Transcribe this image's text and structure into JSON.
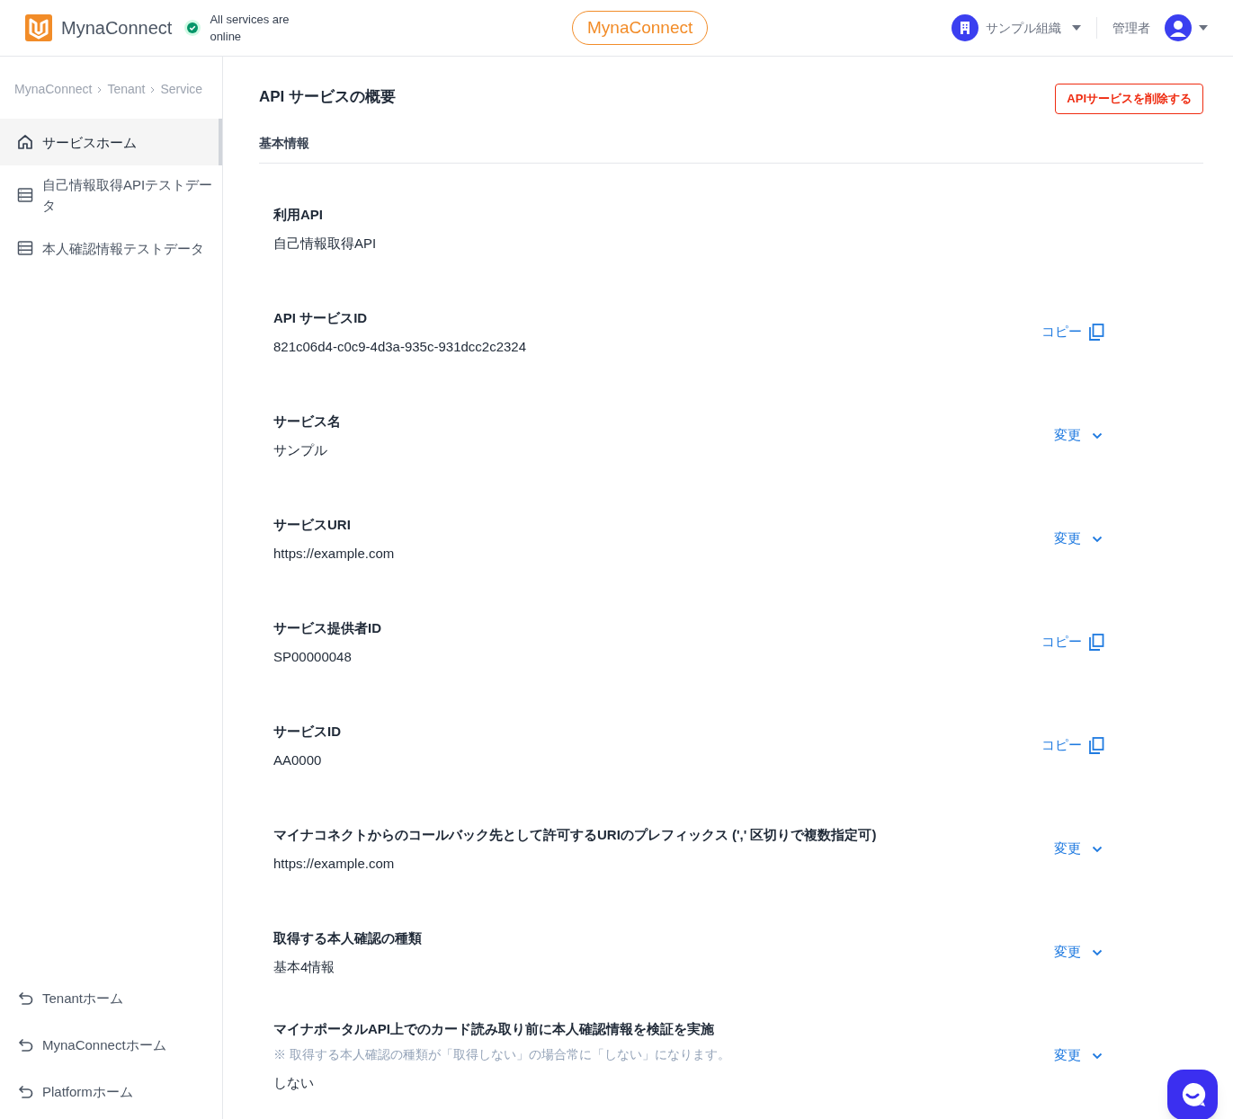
{
  "header": {
    "brand": "MynaConnect",
    "status": "All services are online",
    "center_badge": "MynaConnect",
    "organization": "サンプル組織",
    "role": "管理者"
  },
  "breadcrumb": [
    "MynaConnect",
    "Tenant",
    "Service"
  ],
  "sidebar": {
    "items": [
      {
        "label": "サービスホーム",
        "kind": "home",
        "selected": true
      },
      {
        "label": "自己情報取得APIテストデータ",
        "kind": "data",
        "selected": false
      },
      {
        "label": "本人確認情報テストデータ",
        "kind": "data",
        "selected": false
      }
    ],
    "footer_links": [
      "Tenantホーム",
      "MynaConnectホーム",
      "Platformホーム"
    ]
  },
  "page": {
    "title": "API サービスの概要",
    "delete_button": "APIサービスを削除する",
    "section": "基本情報",
    "fields": [
      {
        "label": "利用API",
        "value": "自己情報取得API"
      },
      {
        "label": "API サービスID",
        "value": "821c06d4-c0c9-4d3a-935c-931dcc2c2324",
        "action": {
          "kind": "copy",
          "label": "コピー"
        }
      },
      {
        "label": "サービス名",
        "value": "サンプル",
        "action": {
          "kind": "change",
          "label": "変更"
        }
      },
      {
        "label": "サービスURI",
        "value": "https://example.com",
        "action": {
          "kind": "change",
          "label": "変更"
        }
      },
      {
        "label": "サービス提供者ID",
        "value": "SP00000048",
        "action": {
          "kind": "copy",
          "label": "コピー"
        }
      },
      {
        "label": "サービスID",
        "value": "AA0000",
        "action": {
          "kind": "copy",
          "label": "コピー"
        }
      },
      {
        "label": "マイナコネクトからのコールバック先として許可するURIのプレフィックス (',' 区切りで複数指定可)",
        "value": "https://example.com",
        "action": {
          "kind": "change",
          "label": "変更"
        }
      },
      {
        "label": "取得する本人確認の種類",
        "value": "基本4情報",
        "action": {
          "kind": "change",
          "label": "変更"
        }
      },
      {
        "label": "マイナポータルAPI上でのカード読み取り前に本人確認情報を検証を実施",
        "note": "※ 取得する本人確認の種類が「取得しない」の場合常に「しない」になります。",
        "value": "しない",
        "action": {
          "kind": "change",
          "label": "変更"
        }
      }
    ]
  }
}
